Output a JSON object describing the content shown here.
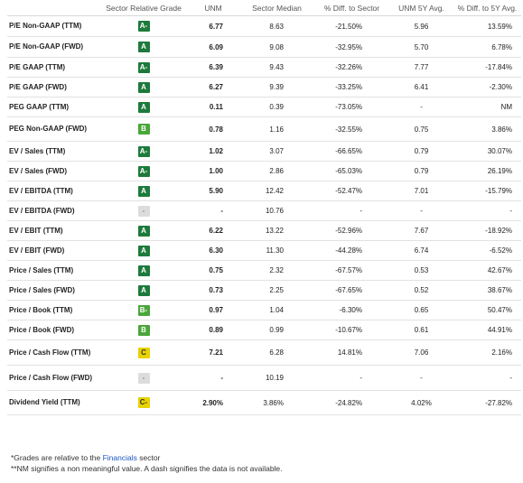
{
  "columns": {
    "metric": "",
    "grade": "Sector Relative Grade",
    "unm": "UNM",
    "median": "Sector Median",
    "pct_sector": "% Diff. to Sector",
    "unm_5y": "UNM 5Y Avg.",
    "pct_5y": "% Diff. to 5Y Avg."
  },
  "grade_colors": {
    "A": "#1e7a3c",
    "A-": "#1e7a3c",
    "B": "#4aa63a",
    "B-": "#4aa63a",
    "C": "#e8d200",
    "C-": "#e8d200",
    "-": "#dcdcdc"
  },
  "rows": [
    {
      "metric": "P/E Non-GAAP (TTM)",
      "grade": "A-",
      "unm": "6.77",
      "median": "8.63",
      "pct_sector": "-21.50%",
      "unm_5y": "5.96",
      "pct_5y": "13.59%"
    },
    {
      "metric": "P/E Non-GAAP (FWD)",
      "grade": "A",
      "unm": "6.09",
      "median": "9.08",
      "pct_sector": "-32.95%",
      "unm_5y": "5.70",
      "pct_5y": "6.78%"
    },
    {
      "metric": "P/E GAAP (TTM)",
      "grade": "A-",
      "unm": "6.39",
      "median": "9.43",
      "pct_sector": "-32.26%",
      "unm_5y": "7.77",
      "pct_5y": "-17.84%"
    },
    {
      "metric": "P/E GAAP (FWD)",
      "grade": "A",
      "unm": "6.27",
      "median": "9.39",
      "pct_sector": "-33.25%",
      "unm_5y": "6.41",
      "pct_5y": "-2.30%"
    },
    {
      "metric": "PEG GAAP (TTM)",
      "grade": "A",
      "unm": "0.11",
      "median": "0.39",
      "pct_sector": "-73.05%",
      "unm_5y": "-",
      "pct_5y": "NM"
    },
    {
      "metric": "PEG Non-GAAP (FWD)",
      "grade": "B",
      "unm": "0.78",
      "median": "1.16",
      "pct_sector": "-32.55%",
      "unm_5y": "0.75",
      "pct_5y": "3.86%"
    },
    {
      "metric": "EV / Sales (TTM)",
      "grade": "A-",
      "unm": "1.02",
      "median": "3.07",
      "pct_sector": "-66.65%",
      "unm_5y": "0.79",
      "pct_5y": "30.07%"
    },
    {
      "metric": "EV / Sales (FWD)",
      "grade": "A-",
      "unm": "1.00",
      "median": "2.86",
      "pct_sector": "-65.03%",
      "unm_5y": "0.79",
      "pct_5y": "26.19%"
    },
    {
      "metric": "EV / EBITDA (TTM)",
      "grade": "A",
      "unm": "5.90",
      "median": "12.42",
      "pct_sector": "-52.47%",
      "unm_5y": "7.01",
      "pct_5y": "-15.79%"
    },
    {
      "metric": "EV / EBITDA (FWD)",
      "grade": "-",
      "unm": "-",
      "median": "10.76",
      "pct_sector": "-",
      "unm_5y": "-",
      "pct_5y": "-"
    },
    {
      "metric": "EV / EBIT (TTM)",
      "grade": "A",
      "unm": "6.22",
      "median": "13.22",
      "pct_sector": "-52.96%",
      "unm_5y": "7.67",
      "pct_5y": "-18.92%"
    },
    {
      "metric": "EV / EBIT (FWD)",
      "grade": "A",
      "unm": "6.30",
      "median": "11.30",
      "pct_sector": "-44.28%",
      "unm_5y": "6.74",
      "pct_5y": "-6.52%"
    },
    {
      "metric": "Price / Sales (TTM)",
      "grade": "A",
      "unm": "0.75",
      "median": "2.32",
      "pct_sector": "-67.57%",
      "unm_5y": "0.53",
      "pct_5y": "42.67%"
    },
    {
      "metric": "Price / Sales (FWD)",
      "grade": "A",
      "unm": "0.73",
      "median": "2.25",
      "pct_sector": "-67.65%",
      "unm_5y": "0.52",
      "pct_5y": "38.67%"
    },
    {
      "metric": "Price / Book (TTM)",
      "grade": "B-",
      "unm": "0.97",
      "median": "1.04",
      "pct_sector": "-6.30%",
      "unm_5y": "0.65",
      "pct_5y": "50.47%"
    },
    {
      "metric": "Price / Book (FWD)",
      "grade": "B",
      "unm": "0.89",
      "median": "0.99",
      "pct_sector": "-10.67%",
      "unm_5y": "0.61",
      "pct_5y": "44.91%"
    },
    {
      "metric": "Price / Cash Flow (TTM)",
      "grade": "C",
      "unm": "7.21",
      "median": "6.28",
      "pct_sector": "14.81%",
      "unm_5y": "7.06",
      "pct_5y": "2.16%"
    },
    {
      "metric": "Price / Cash Flow (FWD)",
      "grade": "-",
      "unm": "-",
      "median": "10.19",
      "pct_sector": "-",
      "unm_5y": "-",
      "pct_5y": "-"
    },
    {
      "metric": "Dividend Yield (TTM)",
      "grade": "C-",
      "unm": "2.90%",
      "median": "3.86%",
      "pct_sector": "-24.82%",
      "unm_5y": "4.02%",
      "pct_5y": "-27.82%"
    }
  ],
  "notes": {
    "line1_prefix": "*Grades are relative to the ",
    "line1_link": "Financials",
    "line1_suffix": " sector",
    "line2": "**NM signifies a non meaningful value. A dash signifies the data is not available."
  }
}
